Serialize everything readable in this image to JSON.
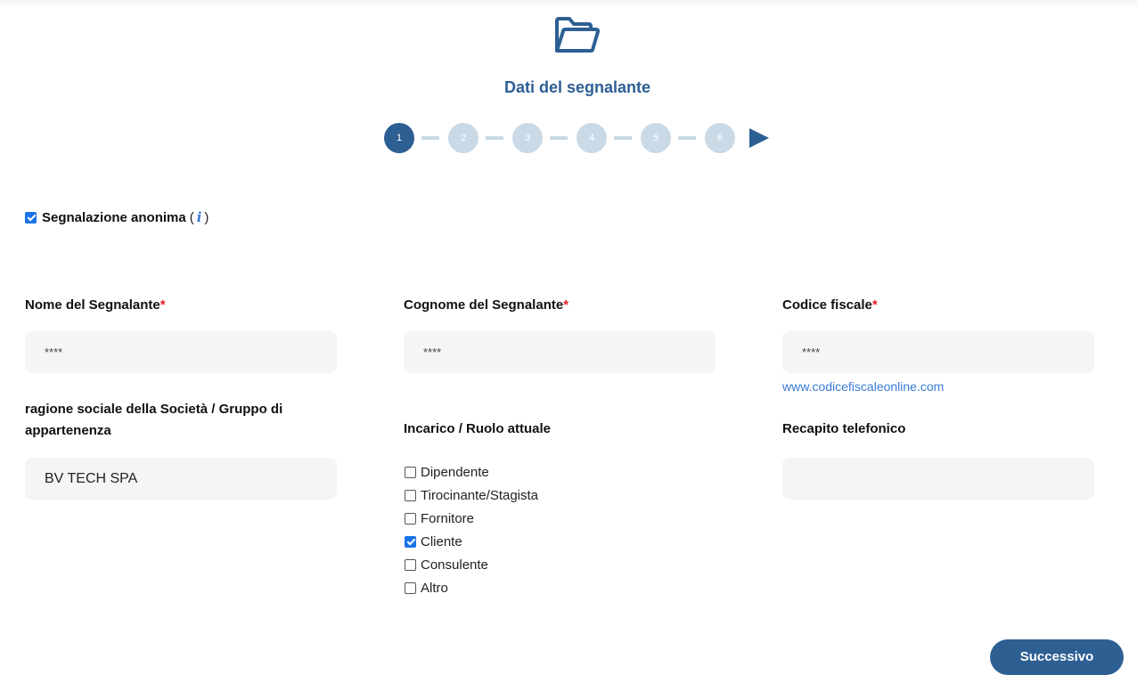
{
  "header": {
    "title": "Dati del segnalante",
    "icon": "folder-icon",
    "steps": [
      "1",
      "2",
      "3",
      "4",
      "5",
      "6"
    ],
    "active_step": 1,
    "next_arrow_icon": "play-icon"
  },
  "anonymous": {
    "label": "Segnalazione anonima",
    "open_paren": "(",
    "info_icon": "i",
    "close_paren": ")",
    "checked": true
  },
  "fields": {
    "nome": {
      "label": "Nome del Segnalante",
      "required": "*",
      "value": "****"
    },
    "cognome": {
      "label": "Cognome del Segnalante",
      "required": "*",
      "value": "****"
    },
    "codice_fiscale": {
      "label": "Codice fiscale",
      "required": "*",
      "value": "****",
      "link": "www.codicefiscaleonline.com"
    },
    "ragione_sociale": {
      "label": "ragione sociale della Società / Gruppo di appartenenza",
      "value": "BV TECH SPA"
    },
    "recapito": {
      "label": "Recapito telefonico",
      "value": ""
    }
  },
  "roles": {
    "label": "Incarico / Ruolo attuale",
    "options": [
      {
        "label": "Dipendente",
        "checked": false
      },
      {
        "label": "Tirocinante/Stagista",
        "checked": false
      },
      {
        "label": "Fornitore",
        "checked": false
      },
      {
        "label": "Cliente",
        "checked": true
      },
      {
        "label": "Consulente",
        "checked": false
      },
      {
        "label": "Altro",
        "checked": false
      }
    ]
  },
  "actions": {
    "next_label": "Successivo"
  },
  "colors": {
    "primary": "#2d5f93",
    "step_inactive": "#c9d9e6",
    "required": "#e02020",
    "link": "#3a7bd5",
    "field_bg": "#f5f5f5"
  }
}
